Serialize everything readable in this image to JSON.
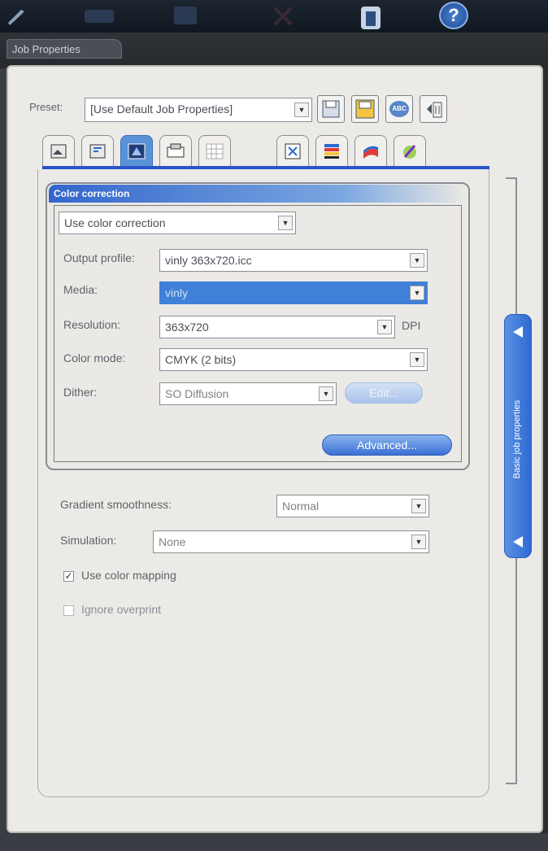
{
  "toolbar": {
    "icons": [
      "wrench-icon",
      "printer-icon",
      "page-icon",
      "cancel-icon",
      "job-icon",
      "help-icon"
    ],
    "help_glyph": "?"
  },
  "window": {
    "title": "Job Properties"
  },
  "preset": {
    "label": "Preset:",
    "value": "[Use Default Job Properties]",
    "buttons": [
      "save-icon",
      "save-as-icon",
      "rename-icon",
      "delete-icon"
    ],
    "rename_glyph": "ABC"
  },
  "tabs": [
    "tab-1",
    "tab-2",
    "tab-color",
    "tab-4",
    "tab-5",
    "tab-6",
    "tab-7",
    "tab-8",
    "tab-9"
  ],
  "color_correction": {
    "title": "Color correction",
    "mode": "Use color correction",
    "output_profile": {
      "label": "Output profile:",
      "value": "vinly 363x720.icc"
    },
    "media": {
      "label": "Media:",
      "value": "vinly"
    },
    "resolution": {
      "label": "Resolution:",
      "value": "363x720",
      "unit": "DPI"
    },
    "color_mode": {
      "label": "Color mode:",
      "value": "CMYK (2 bits)"
    },
    "dither": {
      "label": "Dither:",
      "value": "SO Diffusion",
      "edit_label": "Edit..."
    },
    "advanced_label": "Advanced..."
  },
  "gradient": {
    "label": "Gradient smoothness:",
    "value": "Normal"
  },
  "simulation": {
    "label": "Simulation:",
    "value": "None"
  },
  "use_color_mapping": {
    "label": "Use color mapping",
    "checked": true
  },
  "ignore_overprint": {
    "label": "Ignore overprint",
    "checked": false
  },
  "side_panel": {
    "label": "Basic job properties"
  },
  "colors": {
    "accent": "#3f80d8",
    "header": "#3266cc",
    "panel": "#eceae6"
  }
}
